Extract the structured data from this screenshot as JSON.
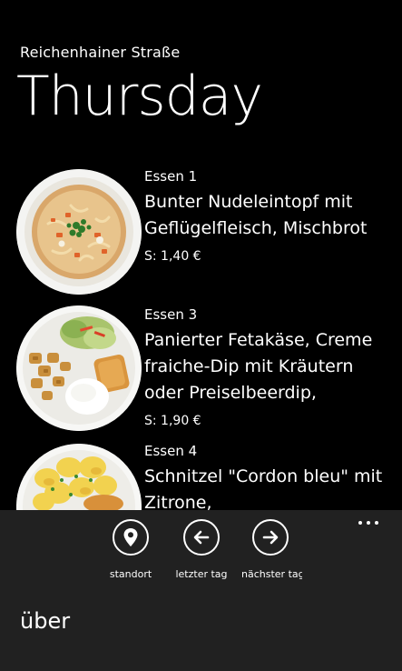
{
  "header": {
    "subtitle": "Reichenhainer Straße",
    "title": "Thursday"
  },
  "meals": [
    {
      "category": "Essen 1",
      "name": "Bunter Nudeleintopf mit Geflügelfleisch, Mischbrot",
      "price": "S: 1,40 €",
      "photo_icon": "soup-bowl-photo"
    },
    {
      "category": "Essen 3",
      "name": "Panierter Fetakäse, Creme fraiche-Dip mit Kräutern oder Preiselbeerdip,",
      "price": "S: 1,90 €",
      "photo_icon": "fried-feta-plate-photo"
    },
    {
      "category": "Essen 4",
      "name": "Schnitzel \"Cordon bleu\" mit Zitrone,",
      "price": "",
      "photo_icon": "potatoes-plate-photo"
    }
  ],
  "app_bar": {
    "buttons": [
      {
        "label": "standort",
        "icon": "location-pin-icon"
      },
      {
        "label": "letzter tag",
        "icon": "arrow-left-icon"
      },
      {
        "label": "nächster tag",
        "icon": "arrow-right-icon"
      }
    ],
    "menu_items": [
      "über"
    ]
  },
  "colors": {
    "background": "#000000",
    "app_bar": "#212121",
    "text": "#ffffff"
  }
}
